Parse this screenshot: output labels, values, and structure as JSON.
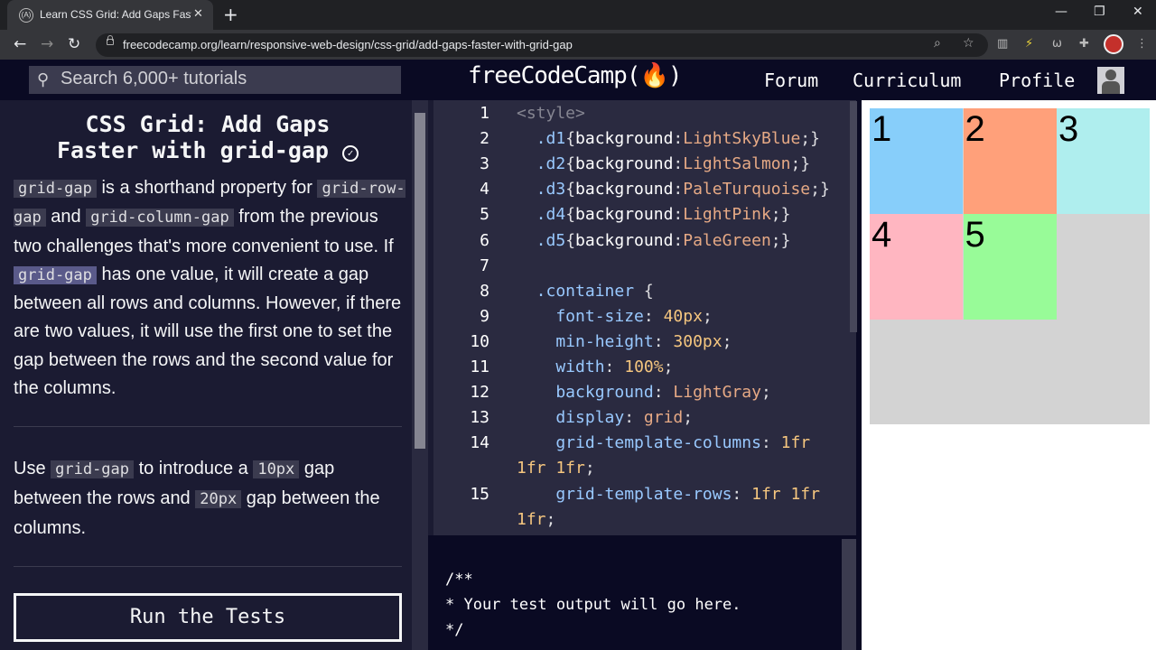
{
  "browser": {
    "tab_title": "Learn CSS Grid: Add Gaps Faster",
    "tab_favicon": "(A)",
    "url": "freecodecamp.org/learn/responsive-web-design/css-grid/add-gaps-faster-with-grid-gap"
  },
  "nav": {
    "search_placeholder": "Search 6,000+ tutorials",
    "logo": "freeCodeCamp(🔥)",
    "links": [
      "Forum",
      "Curriculum",
      "Profile"
    ]
  },
  "challenge": {
    "title_line1": "CSS Grid: Add Gaps",
    "title_line2": "Faster with grid-gap",
    "desc": {
      "code1": "grid-gap",
      "t1": " is a shorthand property for ",
      "code2": "grid-row-gap",
      "t2": " and ",
      "code3": "grid-column-gap",
      "t3": " from the previous two challenges that's more convenient to use. If ",
      "code4": "grid-gap",
      "t4": " has one value, it will create a gap between all rows and columns. However, if there are two values, it will use the first one to set the gap between the rows and the second value for the columns."
    },
    "instr": {
      "t1": "Use ",
      "code1": "grid-gap",
      "t2": " to introduce a ",
      "code2": "10px",
      "t3": " gap between the rows and ",
      "code3": "20px",
      "t4": " gap between the columns."
    },
    "run_button": "Run the Tests"
  },
  "editor": {
    "lines": [
      {
        "n": "1",
        "parts": [
          [
            "tg",
            "<style>"
          ]
        ]
      },
      {
        "n": "2",
        "parts": [
          [
            "sl",
            "  .d1"
          ],
          [
            "pu",
            "{"
          ],
          [
            "pr",
            "background"
          ],
          [
            "pu",
            ":"
          ],
          [
            "nm",
            "LightSkyBlue"
          ],
          [
            "pu",
            ";}"
          ]
        ]
      },
      {
        "n": "3",
        "parts": [
          [
            "sl",
            "  .d2"
          ],
          [
            "pu",
            "{"
          ],
          [
            "pr",
            "background"
          ],
          [
            "pu",
            ":"
          ],
          [
            "nm",
            "LightSalmon"
          ],
          [
            "pu",
            ";}"
          ]
        ]
      },
      {
        "n": "4",
        "parts": [
          [
            "sl",
            "  .d3"
          ],
          [
            "pu",
            "{"
          ],
          [
            "pr",
            "background"
          ],
          [
            "pu",
            ":"
          ],
          [
            "nm",
            "PaleTurquoise"
          ],
          [
            "pu",
            ";}"
          ]
        ]
      },
      {
        "n": "5",
        "parts": [
          [
            "sl",
            "  .d4"
          ],
          [
            "pu",
            "{"
          ],
          [
            "pr",
            "background"
          ],
          [
            "pu",
            ":"
          ],
          [
            "nm",
            "LightPink"
          ],
          [
            "pu",
            ";}"
          ]
        ]
      },
      {
        "n": "6",
        "parts": [
          [
            "sl",
            "  .d5"
          ],
          [
            "pu",
            "{"
          ],
          [
            "pr",
            "background"
          ],
          [
            "pu",
            ":"
          ],
          [
            "nm",
            "PaleGreen"
          ],
          [
            "pu",
            ";}"
          ]
        ]
      },
      {
        "n": "7",
        "parts": []
      },
      {
        "n": "8",
        "parts": [
          [
            "sl",
            "  .container "
          ],
          [
            "pu",
            "{"
          ]
        ]
      },
      {
        "n": "9",
        "parts": [
          [
            "sl",
            "    font-size"
          ],
          [
            "pu",
            ": "
          ],
          [
            "vl",
            "40px"
          ],
          [
            "pu",
            ";"
          ]
        ]
      },
      {
        "n": "10",
        "parts": [
          [
            "sl",
            "    min-height"
          ],
          [
            "pu",
            ": "
          ],
          [
            "vl",
            "300px"
          ],
          [
            "pu",
            ";"
          ]
        ]
      },
      {
        "n": "11",
        "parts": [
          [
            "sl",
            "    width"
          ],
          [
            "pu",
            ": "
          ],
          [
            "vl",
            "100%"
          ],
          [
            "pu",
            ";"
          ]
        ]
      },
      {
        "n": "12",
        "parts": [
          [
            "sl",
            "    background"
          ],
          [
            "pu",
            ": "
          ],
          [
            "nm",
            "LightGray"
          ],
          [
            "pu",
            ";"
          ]
        ]
      },
      {
        "n": "13",
        "parts": [
          [
            "sl",
            "    display"
          ],
          [
            "pu",
            ": "
          ],
          [
            "nm",
            "grid"
          ],
          [
            "pu",
            ";"
          ]
        ]
      },
      {
        "n": "14",
        "parts": [
          [
            "sl",
            "    grid-template-columns"
          ],
          [
            "pu",
            ": "
          ],
          [
            "vl",
            "1fr"
          ]
        ]
      },
      {
        "n": "",
        "parts": [
          [
            "vl",
            "1fr 1fr"
          ],
          [
            "pu",
            ";"
          ]
        ]
      },
      {
        "n": "15",
        "parts": [
          [
            "sl",
            "    grid-template-rows"
          ],
          [
            "pu",
            ": "
          ],
          [
            "vl",
            "1fr 1fr"
          ]
        ]
      },
      {
        "n": "",
        "parts": [
          [
            "vl",
            "1fr"
          ],
          [
            "pu",
            ";"
          ]
        ]
      }
    ]
  },
  "output": {
    "text": "/**\n* Your test output will go here.\n*/"
  },
  "preview": {
    "cells": [
      {
        "label": "1",
        "color": "#87CEFA"
      },
      {
        "label": "2",
        "color": "#FFA07A"
      },
      {
        "label": "3",
        "color": "#AFEEEE"
      },
      {
        "label": "4",
        "color": "#FFB6C1"
      },
      {
        "label": "5",
        "color": "#98FB98"
      }
    ],
    "container_color": "#D3D3D3"
  }
}
